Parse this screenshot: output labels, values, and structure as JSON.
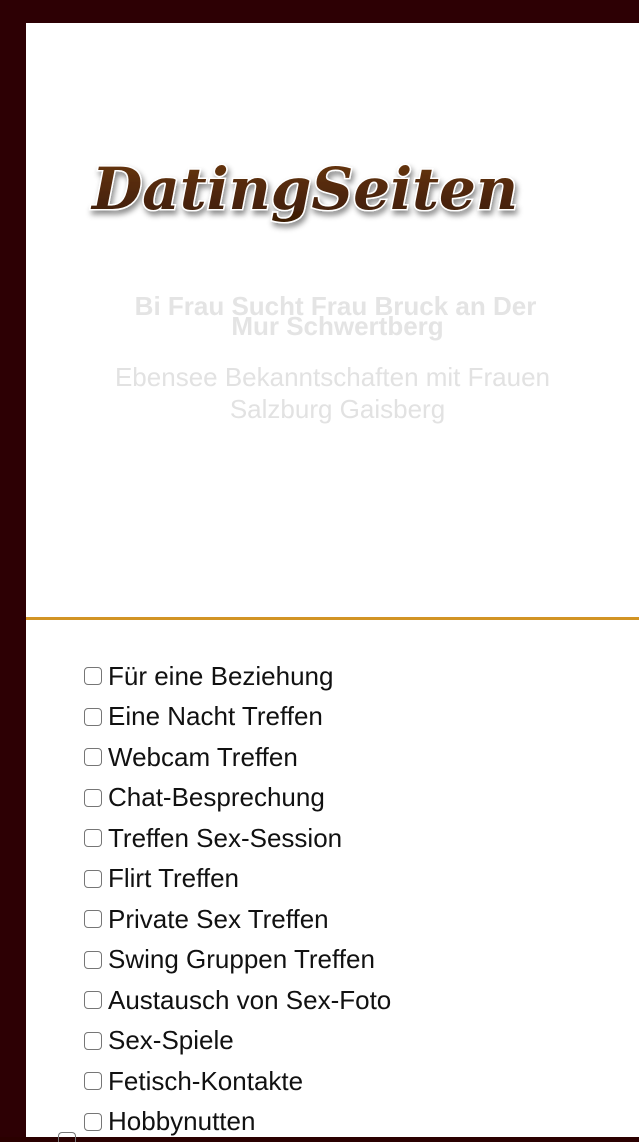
{
  "logo": {
    "text": "DatingSeiten"
  },
  "hero": {
    "title_line1": "Bi Frau Sucht Frau Bruck an Der",
    "title_line2": "Mur Schwertberg",
    "sub_line1": "Ebensee Bekanntschaften mit Frauen",
    "sub_line2": "Salzburg Gaisberg"
  },
  "options": [
    {
      "label": "Für eine Beziehung",
      "checked": false
    },
    {
      "label": "Eine Nacht Treffen",
      "checked": false
    },
    {
      "label": "Webcam Treffen",
      "checked": false
    },
    {
      "label": "Chat-Besprechung",
      "checked": false
    },
    {
      "label": "Treffen Sex-Session",
      "checked": false
    },
    {
      "label": "Flirt Treffen",
      "checked": false
    },
    {
      "label": "Private Sex Treffen",
      "checked": false
    },
    {
      "label": "Swing Gruppen Treffen",
      "checked": false
    },
    {
      "label": "Austausch von Sex-Foto",
      "checked": false
    },
    {
      "label": "Sex-Spiele",
      "checked": false
    },
    {
      "label": "Fetisch-Kontakte",
      "checked": false
    },
    {
      "label": "Hobbynutten",
      "checked": false
    }
  ],
  "colors": {
    "frame": "#2d0004",
    "divider": "#d29424",
    "logo_fill": "#4a2408",
    "logo_outline": "#ffffff"
  }
}
